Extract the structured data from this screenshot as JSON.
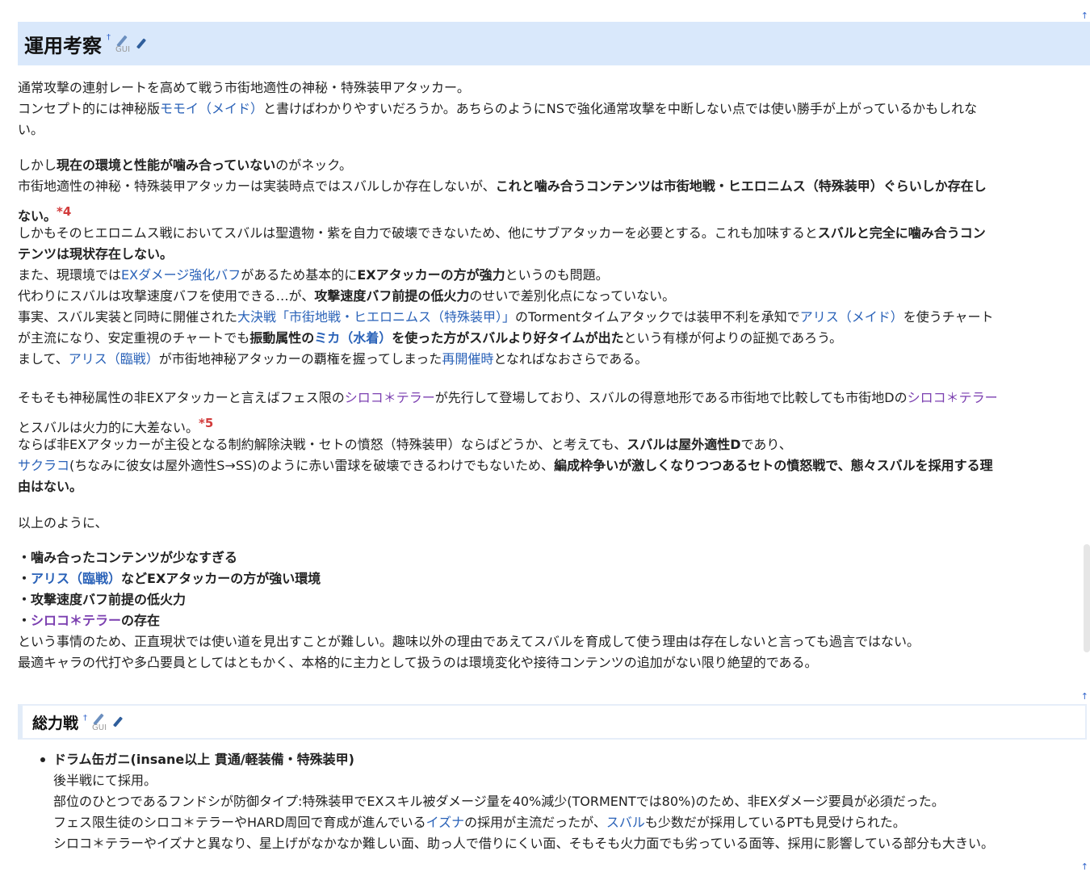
{
  "section1": {
    "title": "運用考察",
    "anchor_mark": "†",
    "gui_label": "GUI"
  },
  "p1": {
    "l1": "通常攻撃の連射レートを高めて戦う市街地適性の神秘・特殊装甲アタッカー。",
    "l2a": "コンセプト的には神秘版",
    "l2_link": "モモイ（メイド）",
    "l2b": "と書けばわかりやすいだろうか。あちらのようにNSで強化通常攻撃を中断しない点では使い勝手が上がっているかもしれな",
    "l3": "い。"
  },
  "p2": {
    "l1a": "しかし",
    "l1_bold": "現在の環境と性能が噛み合っていない",
    "l1b": "のがネック。",
    "l2a": "市街地適性の神秘・特殊装甲アタッカーは実装時点ではスバルしか存在しないが、",
    "l2_bold": "これと噛み合うコンテンツは市街地戦・ヒエロニムス（特殊装甲）ぐらいしか存在し",
    "l3_bold": "ない。",
    "l3_note": "*4",
    "l4a": "しかもそのヒエロニムス戦においてスバルは聖遺物・紫を自力で破壊できないため、他にサブアタッカーを必要とする。これも加味すると",
    "l4_bold": "スバルと完全に噛み合うコン",
    "l5_bold": "テンツは現状存在しない。",
    "l6a": "また、現環境では",
    "l6_link": "EXダメージ強化バフ",
    "l6b": "があるため基本的に",
    "l6_bold": "EXアタッカーの方が強力",
    "l6c": "というのも問題。",
    "l7a": "代わりにスバルは攻撃速度バフを使用できる…が、",
    "l7_bold": "攻撃速度バフ前提の低火力",
    "l7b": "のせいで差別化点になっていない。",
    "l8a": "事実、スバル実装と同時に開催された",
    "l8_link": "大決戦「市街地戦・ヒエロニムス（特殊装甲）」",
    "l8b": "のTormentタイムアタックでは装甲不利を承知で",
    "l8_link2": "アリス（メイド）",
    "l8c": "を使うチャート",
    "l9a": "が主流になり、安定重視のチャートでも",
    "l9_bold1": "振動属性の",
    "l9_link": "ミカ（水着）",
    "l9_bold2": "を使った方がスバルより好タイムが出た",
    "l9b": "という有様が何よりの証拠であろう。",
    "l10a": "まして、",
    "l10_link": "アリス（臨戦）",
    "l10b": "が市街地神秘アタッカーの覇権を握ってしまった",
    "l10_link2": "再開催時",
    "l10c": "となればなおさらである。"
  },
  "p3": {
    "l1a": "そもそも神秘属性の非EXアタッカーと言えばフェス限の",
    "l1_link": "シロコ＊テラー",
    "l1b": "が先行して登場しており、スバルの得意地形である市街地で比較しても市街地Dの",
    "l1_link2": "シロコ＊テラー",
    "l2a": "とスバルは火力的に大差ない。",
    "l2_note": "*5",
    "l3a": "ならば非EXアタッカーが主役となる制約解除決戦・セトの憤怒（特殊装甲）ならばどうか、と考えても、",
    "l3_bold": "スバルは屋外適性D",
    "l3b": "であり、",
    "l4_link": "サクラコ",
    "l4a": "(ちなみに彼女は屋外適性S→SS)のように赤い雷球を破壊できるわけでもないため、",
    "l4_bold": "編成枠争いが激しくなりつつあるセトの憤怒戦で、態々スバルを採用する理",
    "l5_bold": "由はない。"
  },
  "p4": {
    "l1": "以上のように、"
  },
  "p5": {
    "l1": "・噛み合ったコンテンツが少なすぎる",
    "l2a": "・",
    "l2_link": "アリス（臨戦）",
    "l2b": "などEXアタッカーの方が強い環境",
    "l3": "・攻撃速度バフ前提の低火力",
    "l4a": "・",
    "l4_link": "シロコ＊テラー",
    "l4b": "の存在",
    "l5": "という事情のため、正直現状では使い道を見出すことが難しい。趣味以外の理由であえてスバルを育成して使う理由は存在しないと言っても過言ではない。",
    "l6": "最適キャラの代打や多凸要員としてはともかく、本格的に主力として扱うのは環境変化や接待コンテンツの追加がない限り絶望的である。"
  },
  "section2": {
    "title": "総力戦",
    "anchor_mark": "†",
    "gui_label": "GUI"
  },
  "item1": {
    "title": "ドラム缶ガニ(insane以上 貫通/軽装備・特殊装甲)",
    "l1": "後半戦にて採用。",
    "l2": "部位のひとつであるフンドシが防御タイプ:特殊装甲でEXスキル被ダメージ量を40%減少(TORMENTでは80%)のため、非EXダメージ要員が必須だった。",
    "l3a": "フェス限生徒のシロコ＊テラーやHARD周回で育成が進んでいる",
    "l3_link": "イズナ",
    "l3b": "の採用が主流だったが、",
    "l3_link2": "スバル",
    "l3c": "も少数だが採用しているPTも見受けられた。",
    "l4": "シロコ＊テラーやイズナと異なり、星上げがなかなか難しい面、助っ人で借りにくい面、そもそも火力面でも劣っている面等、採用に影響している部分も大きい。"
  },
  "page_top_mark": "↑"
}
